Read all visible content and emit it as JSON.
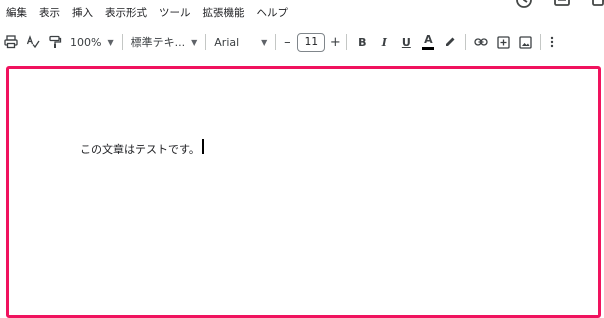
{
  "menu": [
    "編集",
    "表示",
    "挿入",
    "表示形式",
    "ツール",
    "拡張機能",
    "ヘルプ"
  ],
  "toolbar": {
    "zoom": "100%",
    "style": "標準テキ...",
    "font": "Arial",
    "font_size": "11",
    "minus": "–",
    "plus": "+",
    "bold": "B",
    "italic": "I",
    "underline": "U",
    "text_color": "A"
  },
  "document": {
    "text": "この文章はテストです。"
  },
  "colors": {
    "highlight_border": "#f0125e"
  }
}
